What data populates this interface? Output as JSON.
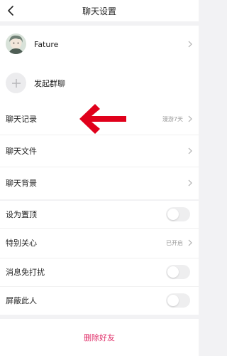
{
  "header": {
    "title": "聊天设置",
    "back_icon": "chevron-left-icon"
  },
  "contact": {
    "name": "Fature",
    "chevron_icon": "chevron-right-icon"
  },
  "group": {
    "create_label": "发起群聊",
    "add_icon": "plus-icon"
  },
  "chat": {
    "history_label": "聊天记录",
    "history_value": "漫游7天",
    "files_label": "聊天文件",
    "background_label": "聊天背景"
  },
  "settings": {
    "pin_label": "设为置顶",
    "pin_on": false,
    "special_label": "特别关心",
    "special_value": "已开启",
    "dnd_label": "消息免打扰",
    "dnd_on": false,
    "block_label": "屏蔽此人",
    "block_on": false
  },
  "footer": {
    "delete_label": "删除好友"
  },
  "annotation": {
    "arrow_icon": "red-arrow-left-icon"
  },
  "colors": {
    "background": "#f2f2f4",
    "delete_text": "#e0306a",
    "arrow": "#e0001b",
    "value_text": "#9a9a9a",
    "toggle_off": "#eeeeef"
  }
}
